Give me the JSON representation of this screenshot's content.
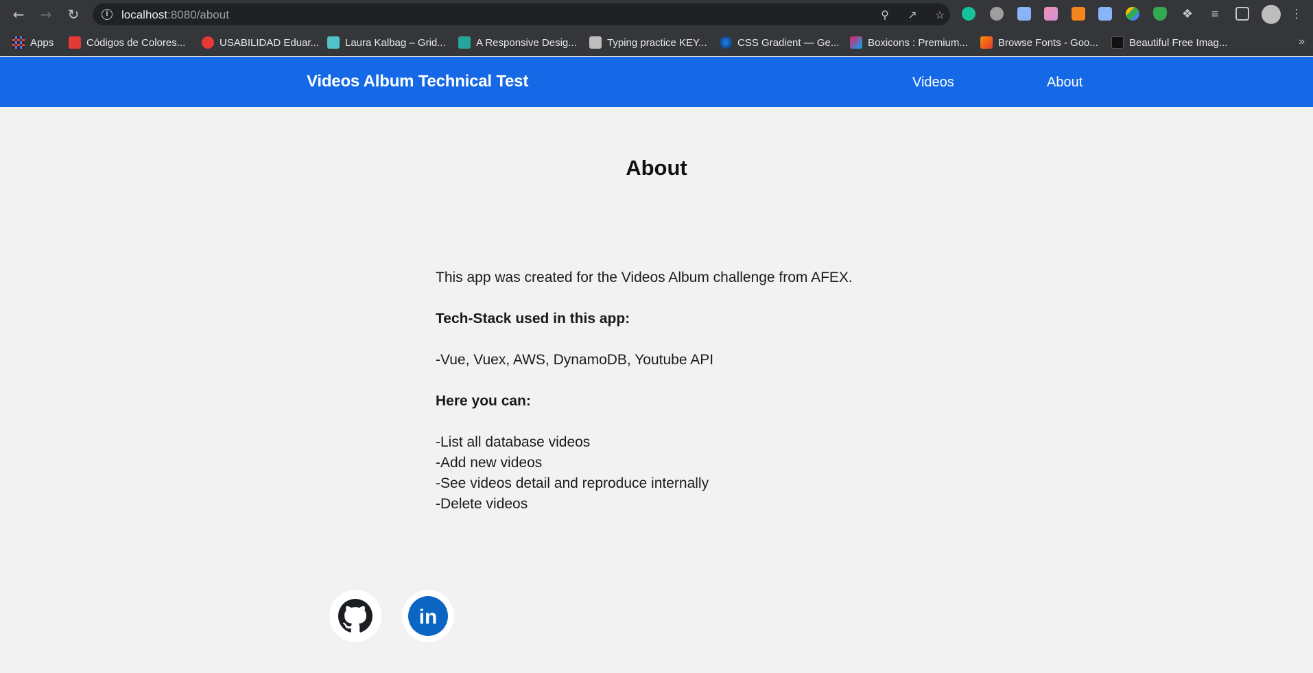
{
  "browser": {
    "url_host": "localhost",
    "url_path": ":8080/about",
    "bookmarks": [
      {
        "label": "Apps",
        "color": "#ea4335"
      },
      {
        "label": "Códigos de Colores...",
        "color": "#e53935"
      },
      {
        "label": "USABILIDAD Eduar...",
        "color": "#e53935"
      },
      {
        "label": "Laura Kalbag – Grid...",
        "color": "#4fc3c7"
      },
      {
        "label": "A Responsive Desig...",
        "color": "#26a69a"
      },
      {
        "label": "Typing practice KEY...",
        "color": "#bdbdbd"
      },
      {
        "label": "CSS Gradient — Ge...",
        "color": "#1e88e5"
      },
      {
        "label": "Boxicons : Premium...",
        "color": "#e91e63"
      },
      {
        "label": "Browse Fonts - Goo...",
        "color": "#fb8c00"
      },
      {
        "label": "Beautiful Free Imag...",
        "color": "#111111"
      }
    ],
    "more_label": "»"
  },
  "header": {
    "brand": "Videos Album Technical Test",
    "nav": [
      {
        "label": "Videos"
      },
      {
        "label": "About"
      }
    ],
    "color": "#1569e6"
  },
  "main": {
    "title": "About",
    "intro": "This app was created for the Videos Album challenge from AFEX.",
    "stack_heading": "Tech-Stack used in this app:",
    "stack": "-Vue, Vuex, AWS, DynamoDB, Youtube API",
    "features_heading": "Here you can:",
    "features": [
      "-List all database videos",
      "-Add new videos",
      "-See videos detail and reproduce internally",
      "-Delete videos"
    ]
  },
  "social": [
    {
      "icon": "github-icon"
    },
    {
      "icon": "linkedin-icon",
      "label": "in"
    }
  ]
}
